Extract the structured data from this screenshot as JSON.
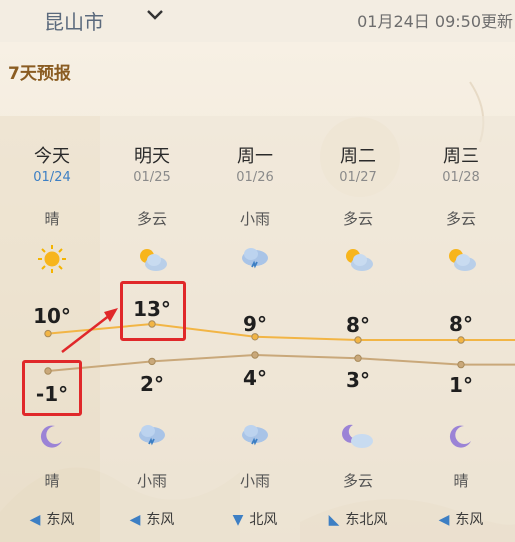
{
  "header": {
    "city": "昆山市",
    "update_time": "01月24日 09:50更新"
  },
  "panel": {
    "title": "7天预报"
  },
  "days": [
    {
      "day": "今天",
      "date": "01/24",
      "day_cond": "晴",
      "day_icon": "sun-icon",
      "high": "10°",
      "low": "-1°",
      "night_icon": "moon-icon",
      "night_cond": "晴",
      "wind": "东风",
      "wind_dir": "left"
    },
    {
      "day": "明天",
      "date": "01/25",
      "day_cond": "多云",
      "day_icon": "partly-cloudy-icon",
      "high": "13°",
      "low": "2°",
      "night_icon": "rain-icon",
      "night_cond": "小雨",
      "wind": "东风",
      "wind_dir": "left"
    },
    {
      "day": "周一",
      "date": "01/26",
      "day_cond": "小雨",
      "day_icon": "rain-icon",
      "high": "9°",
      "low": "4°",
      "night_icon": "rain-icon",
      "night_cond": "小雨",
      "wind": "北风",
      "wind_dir": "down"
    },
    {
      "day": "周二",
      "date": "01/27",
      "day_cond": "多云",
      "day_icon": "partly-cloudy-icon",
      "high": "8°",
      "low": "3°",
      "night_icon": "moon-cloud-icon",
      "night_cond": "多云",
      "wind": "东北风",
      "wind_dir": "down-left"
    },
    {
      "day": "周三",
      "date": "01/28",
      "day_cond": "多云",
      "day_icon": "partly-cloudy-icon",
      "high": "8°",
      "low": "1°",
      "night_icon": "moon-icon",
      "night_cond": "晴",
      "wind": "东风",
      "wind_dir": "left"
    }
  ],
  "colors": {
    "high_line": "#f2b545",
    "low_line": "#c9a87a",
    "highlight": "#e0282a",
    "accent": "#3d7fc4"
  }
}
